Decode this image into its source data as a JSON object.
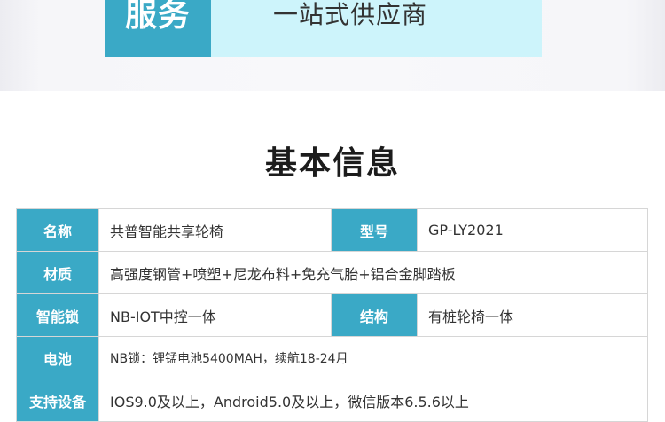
{
  "banner": {
    "left": "服务",
    "right": "一站式供应商"
  },
  "section_title": "基本信息",
  "specs": {
    "name_label": "名称",
    "name_value": "共普智能共享轮椅",
    "model_label": "型号",
    "model_value": "GP-LY2021",
    "material_label": "材质",
    "material_value": "高强度钢管+喷塑+尼龙布料+免充气胎+铝合金脚踏板",
    "lock_label": "智能锁",
    "lock_value": "NB-IOT中控一体",
    "structure_label": "结构",
    "structure_value": "有桩轮椅一体",
    "battery_label": "电池",
    "battery_value": "NB锁：锂锰电池5400MAH，续航18-24月",
    "devices_label": "支持设备",
    "devices_value": "IOS9.0及以上，Android5.0及以上，微信版本6.5.6以上"
  },
  "colors": {
    "accent": "#3aa9c6",
    "banner_bg": "#cdf4fb"
  }
}
